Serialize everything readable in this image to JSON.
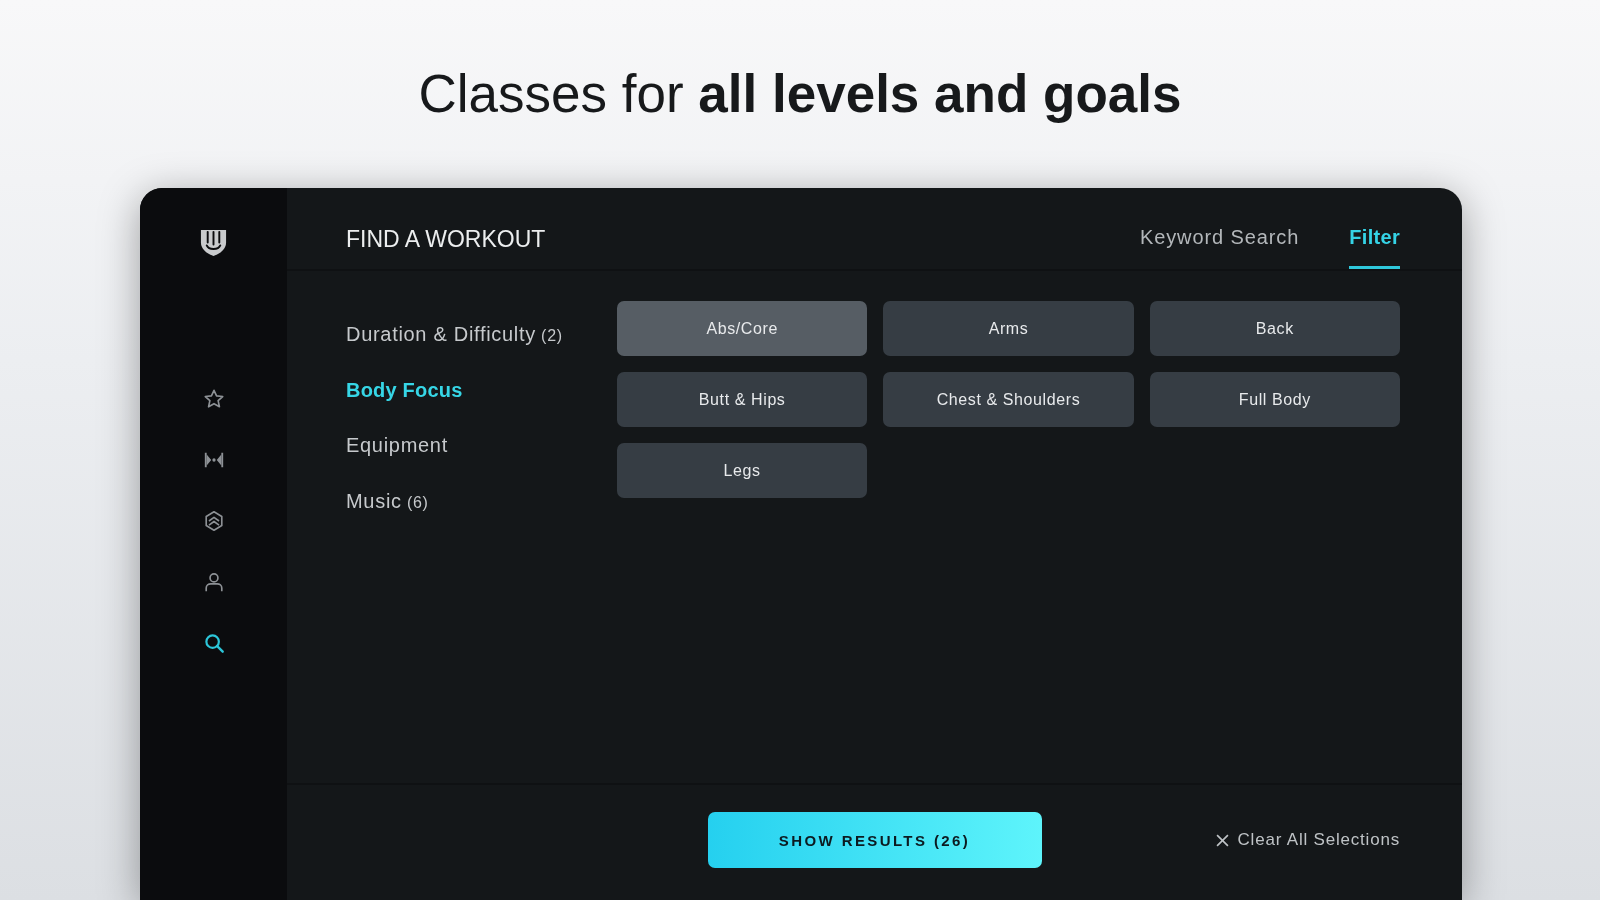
{
  "headline": "Classes for **all levels and goals**",
  "sidebar": {
    "nav_items": [
      {
        "selected": false
      },
      {
        "selected": false
      },
      {
        "selected": false
      },
      {
        "selected": false
      },
      {
        "selected": true
      }
    ]
  },
  "header": {
    "title": "FIND A WORKOUT",
    "tabs": [
      {
        "label": "Keyword Search",
        "selected": false
      },
      {
        "label": "Filter",
        "selected": true
      }
    ]
  },
  "filter_categories": [
    {
      "label": "Duration & Difficulty",
      "count": "(2)",
      "selected": false
    },
    {
      "label": "Body Focus",
      "selected": true
    },
    {
      "label": "Equipment",
      "selected": false
    },
    {
      "label": "Music",
      "count": "(6)",
      "selected": false
    }
  ],
  "options": [
    {
      "label": "Abs/Core",
      "selected": true
    },
    {
      "label": "Arms",
      "selected": false
    },
    {
      "label": "Back",
      "selected": false
    },
    {
      "label": "Butt & Hips",
      "selected": false
    },
    {
      "label": "Chest & Shoulders",
      "selected": false
    },
    {
      "label": "Full Body",
      "selected": false
    },
    {
      "label": "Legs",
      "selected": false
    }
  ],
  "footer": {
    "show_results_button": "SHOW RESULTS (26)",
    "clear_button": "Clear All Selections"
  }
}
